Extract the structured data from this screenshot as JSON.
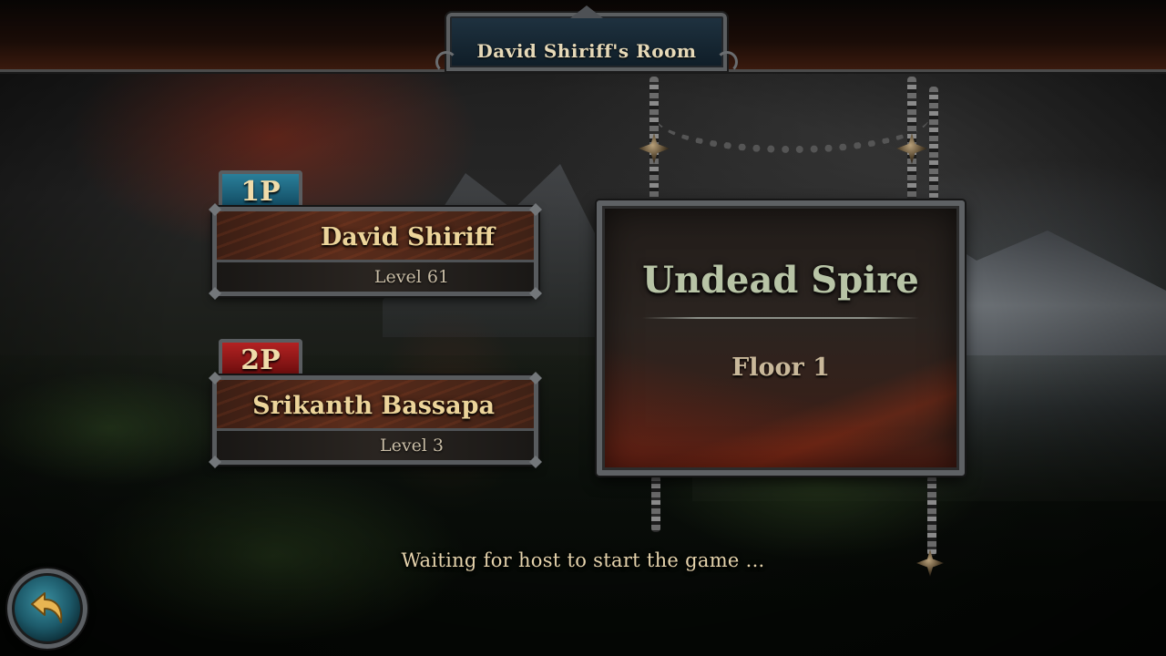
{
  "header": {
    "room_title": "David Shiriff's Room"
  },
  "players": [
    {
      "slot": "1P",
      "name": "David Shiriff",
      "level": "Level 61",
      "slot_color": "#1a6f8a"
    },
    {
      "slot": "2P",
      "name": "Srikanth Bassapa",
      "level": "Level 3",
      "slot_color": "#a01c1c"
    }
  ],
  "dungeon": {
    "name": "Undead Spire",
    "floor": "Floor 1"
  },
  "status": {
    "waiting_text": "Waiting for host to start the game ..."
  },
  "controls": {
    "back_icon": "back-arrow-icon"
  }
}
